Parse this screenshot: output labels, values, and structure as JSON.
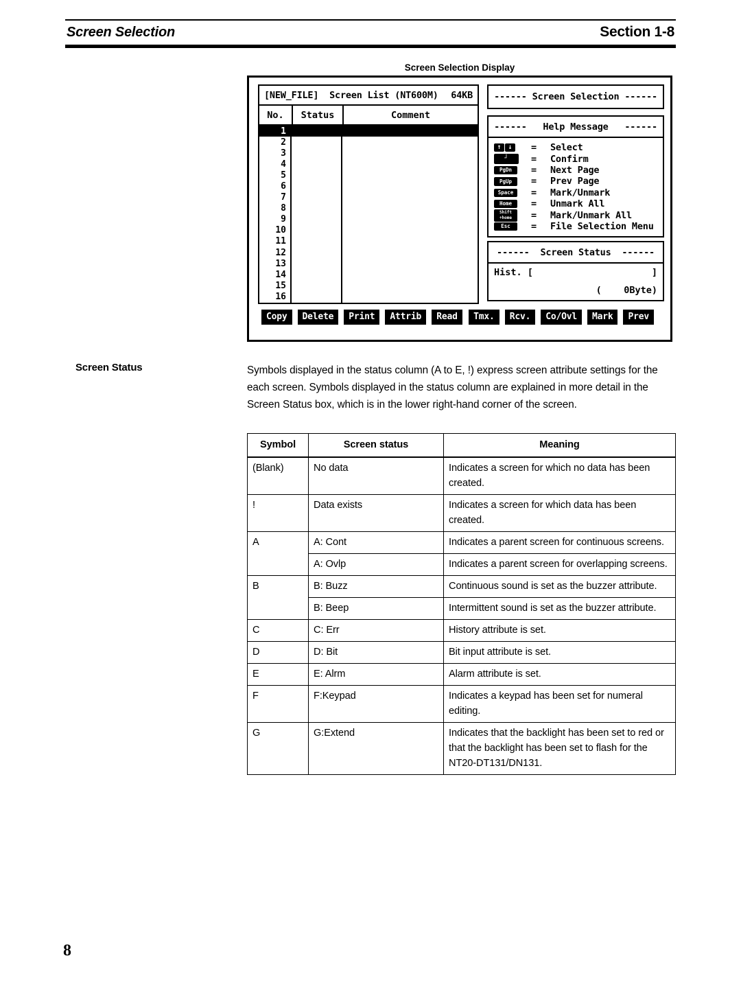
{
  "header": {
    "left_title": "Screen Selection",
    "right_title": "Section 1-8"
  },
  "figure": {
    "caption": "Screen Selection Display",
    "screen_list": {
      "title_left": "[NEW_FILE]  Screen List (NT600M)",
      "title_right": "64KB",
      "columns": [
        "No.",
        "Status",
        "Comment"
      ],
      "rows": [
        "1",
        "2",
        "3",
        "4",
        "5",
        "6",
        "7",
        "8",
        "9",
        "10",
        "11",
        "12",
        "13",
        "14",
        "15",
        "16"
      ],
      "selected_row": "1"
    },
    "screen_selection_box": {
      "title": "------ Screen Selection ------"
    },
    "help_message_box": {
      "title": "------   Help Message   ------",
      "equals": "=",
      "items": [
        {
          "key_type": "arrows",
          "key_up": "↑",
          "key_down": "↓",
          "label": "Select"
        },
        {
          "key_type": "enter",
          "key": "┘",
          "label": "Confirm"
        },
        {
          "key_type": "cap",
          "key": "PgDn",
          "label": "Next Page"
        },
        {
          "key_type": "cap",
          "key": "PgUp",
          "label": "Prev Page"
        },
        {
          "key_type": "cap",
          "key": "Space",
          "label": "Mark/Unmark"
        },
        {
          "key_type": "cap",
          "key": "Home",
          "label": "Unmark All"
        },
        {
          "key_type": "two",
          "key_line1": "Shift",
          "key_line2": "+home",
          "label": "Mark/Unmark All"
        },
        {
          "key_type": "cap",
          "key": "Esc",
          "label": "File Selection Menu"
        }
      ]
    },
    "screen_status_box": {
      "title": "------  Screen Status  ------",
      "hist_label": "Hist. [",
      "hist_close": "]",
      "byte_text": "(    0Byte)"
    },
    "function_keys_left": [
      "Copy",
      "Delete",
      "Print",
      "Attrib",
      "Read"
    ],
    "function_keys_right": [
      "Tmx.",
      "Rcv.",
      "Co/Ovl",
      "Mark",
      "Prev"
    ]
  },
  "body": {
    "label": "Screen Status",
    "paragraph": "Symbols displayed in the status column (A to E, !) express screen attribute settings for the each screen. Symbols displayed in the status column are explained in more detail in the Screen Status box, which is in the lower right-hand corner of the screen."
  },
  "table": {
    "headers": [
      "Symbol",
      "Screen status",
      "Meaning"
    ],
    "rows": [
      {
        "symbol": "(Blank)",
        "status": "No data",
        "meaning": "Indicates a screen for which no data has been created.",
        "group_start": true,
        "symbol_rowspan": 1
      },
      {
        "symbol": "!",
        "status": "Data exists",
        "meaning": "Indicates a screen for which data has been created.",
        "group_start": true,
        "symbol_rowspan": 1
      },
      {
        "symbol": "A",
        "status": "A: Cont",
        "meaning": "Indicates a parent screen for continuous screens.",
        "group_start": true,
        "symbol_rowspan": 2
      },
      {
        "symbol": "",
        "status": "A: Ovlp",
        "meaning": "Indicates a parent screen for overlapping screens.",
        "group_start": false,
        "symbol_rowspan": 0
      },
      {
        "symbol": "B",
        "status": "B: Buzz",
        "meaning": "Continuous sound is set as the buzzer attribute.",
        "group_start": true,
        "symbol_rowspan": 2
      },
      {
        "symbol": "",
        "status": "B: Beep",
        "meaning": "Intermittent sound is set as the buzzer attribute.",
        "group_start": false,
        "symbol_rowspan": 0
      },
      {
        "symbol": "C",
        "status": "C: Err",
        "meaning": "History attribute is set.",
        "group_start": true,
        "symbol_rowspan": 1
      },
      {
        "symbol": "D",
        "status": "D: Bit",
        "meaning": "Bit input attribute is set.",
        "group_start": true,
        "symbol_rowspan": 1
      },
      {
        "symbol": "E",
        "status": "E: Alrm",
        "meaning": "Alarm attribute is set.",
        "group_start": true,
        "symbol_rowspan": 1
      },
      {
        "symbol": "F",
        "status": "F:Keypad",
        "meaning": "Indicates a keypad has been set for numeral editing.",
        "group_start": true,
        "symbol_rowspan": 1
      },
      {
        "symbol": "G",
        "status": "G:Extend",
        "meaning": "Indicates that the backlight has been set to red or that the backlight has been set to flash for the NT20-DT131/DN131.",
        "group_start": true,
        "symbol_rowspan": 1
      }
    ]
  },
  "footer": {
    "page_number": "8"
  }
}
